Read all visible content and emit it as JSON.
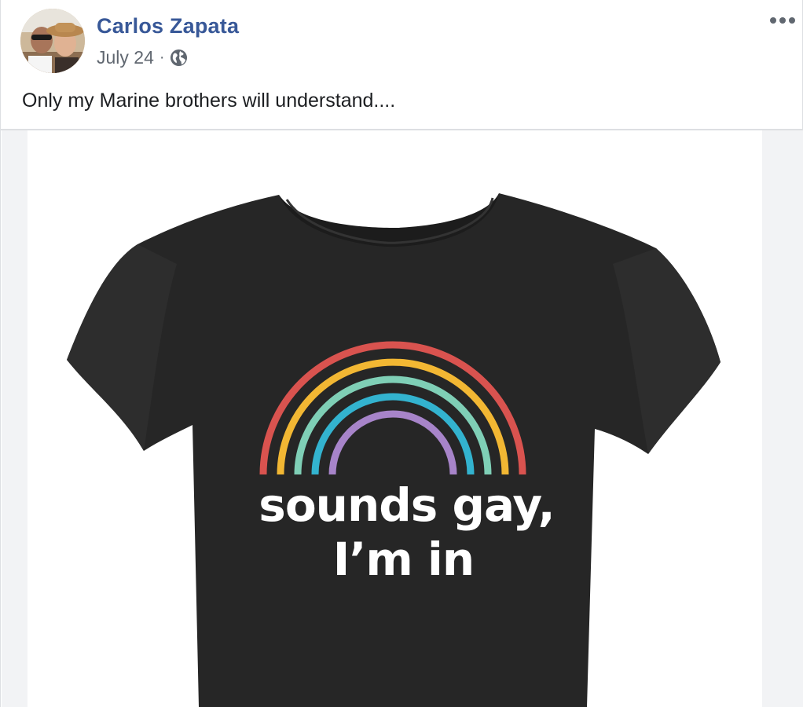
{
  "post": {
    "author": "Carlos Zapata",
    "date": "July 24",
    "separator": "·",
    "audience_icon": "globe-icon",
    "more_icon": "ellipsis-icon",
    "text": "Only my Marine brothers will understand....",
    "photo": {
      "shirt_text_line1": "sounds gay,",
      "shirt_text_line2": "I’m in",
      "shirt_color": "#262626",
      "rainbow_colors": [
        "#d9534f",
        "#f2b733",
        "#7fcfb6",
        "#33b3cf",
        "#a784c9"
      ]
    }
  },
  "colors": {
    "link": "#385898",
    "secondary_text": "#606770",
    "primary_text": "#1c1e21"
  }
}
